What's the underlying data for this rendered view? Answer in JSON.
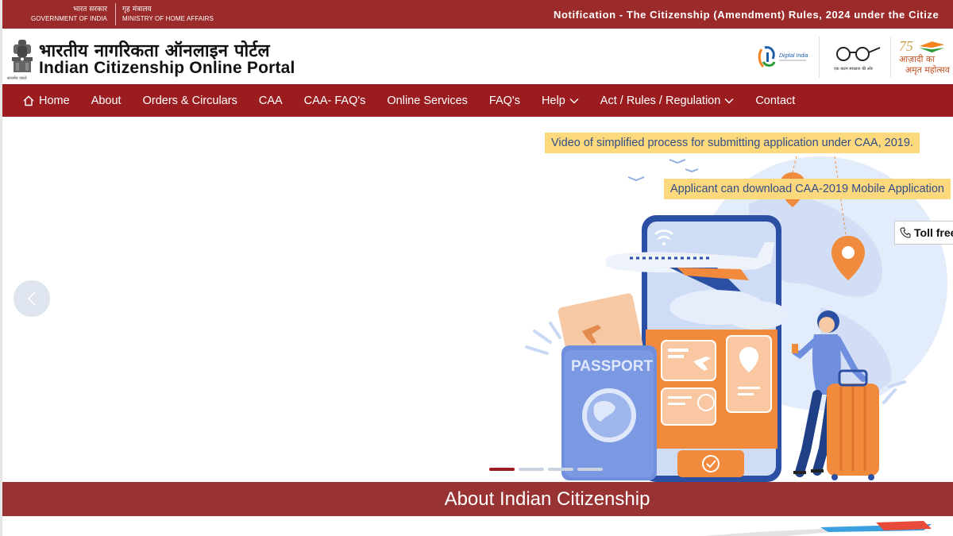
{
  "gov": {
    "left_hi": "भारत सरकार",
    "left_en": "GOVERNMENT OF INDIA",
    "right_hi": "गृह मंत्रालय",
    "right_en": "MINISTRY OF HOME AFFAIRS",
    "notice": "Notification - The Citizenship (Amendment) Rules, 2024 under the Citize"
  },
  "header": {
    "title_hi": "भारतीय नागरिकता ऑनलाइन पोर्टल",
    "title_en": "Indian Citizenship Online Portal",
    "emblem_caption": "सत्यमेव जयते",
    "logos": {
      "digital_india": "Digital India",
      "swachh_bharat": "एक कदम स्वच्छता की ओर",
      "amrit_mahotsav_1": "आज़ादी का",
      "amrit_mahotsav_2": "अमृत महोत्सव"
    }
  },
  "nav": {
    "items": [
      {
        "label": "Home"
      },
      {
        "label": "About"
      },
      {
        "label": "Orders & Circulars"
      },
      {
        "label": "CAA"
      },
      {
        "label": "CAA- FAQ's"
      },
      {
        "label": "Online Services"
      },
      {
        "label": "FAQ's"
      },
      {
        "label": "Help"
      },
      {
        "label": "Act / Rules / Regulation"
      },
      {
        "label": "Contact"
      }
    ]
  },
  "hero": {
    "callout_video": "Video of simplified process for submitting application under CAA, 2019.",
    "callout_app": "Applicant can download CAA-2019 Mobile Application",
    "tollfree": "Toll free",
    "passport": "PASSPORT",
    "slides": 4,
    "active_slide": 1
  },
  "about": {
    "title": "About Indian Citizenship"
  },
  "colors": {
    "gov_strip": "#9b2a2a",
    "nav": "#9b1c1f",
    "about_band": "#993333",
    "callout": "#fcd97c"
  }
}
